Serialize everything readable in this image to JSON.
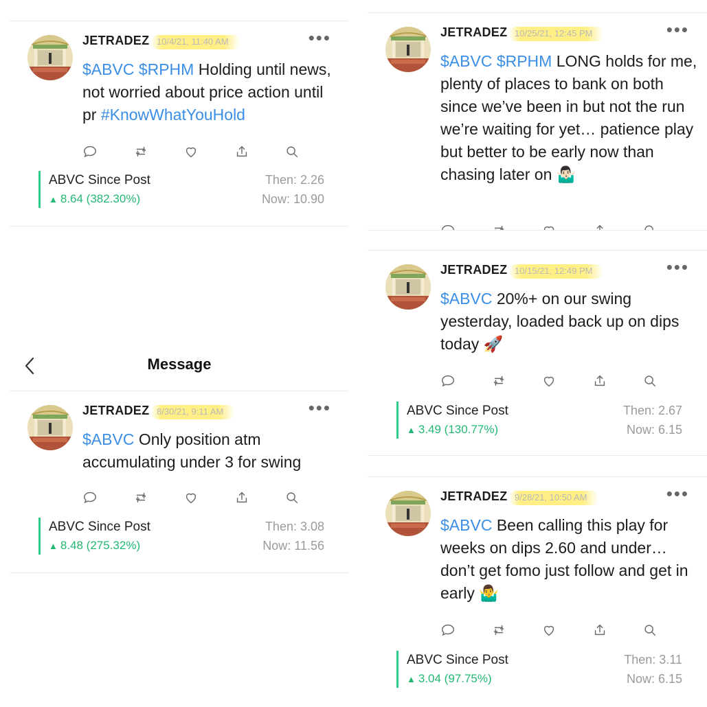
{
  "posts": {
    "p1": {
      "username": "JETRADEZ",
      "timestamp": "10/4/21, 11:40 AM",
      "segments": [
        {
          "text": "$ABVC $RPHM",
          "tag": true
        },
        {
          "text": " Holding until news, not worried about price action until pr ",
          "tag": false
        },
        {
          "text": "#KnowWhatYouHold",
          "tag": true
        }
      ],
      "stats": {
        "label": "ABVC Since Post",
        "change": "8.64 (382.30%)",
        "then": "Then: 2.26",
        "now": "Now: 10.90"
      }
    },
    "p2": {
      "username": "JETRADEZ",
      "timestamp": "8/30/21, 9:11 AM",
      "segments": [
        {
          "text": "$ABVC",
          "tag": true
        },
        {
          "text": " Only position atm accumulating under 3 for swing",
          "tag": false
        }
      ],
      "stats": {
        "label": "ABVC Since Post",
        "change": "8.48 (275.32%)",
        "then": "Then: 3.08",
        "now": "Now: 11.56"
      }
    },
    "p3": {
      "username": "JETRADEZ",
      "timestamp": "10/25/21, 12:45 PM",
      "segments": [
        {
          "text": "$ABVC $RPHM",
          "tag": true
        },
        {
          "text": " LONG holds for me, plenty of places to bank on both since we’ve been in but not the run we’re waiting for yet… patience play but better to be early now than chasing later on 🤷🏻‍♂️",
          "tag": false
        }
      ]
    },
    "p4": {
      "username": "JETRADEZ",
      "timestamp": "10/15/21, 12:49 PM",
      "segments": [
        {
          "text": "$ABVC",
          "tag": true
        },
        {
          "text": " 20%+ on our swing yesterday, loaded back up on dips today 🚀",
          "tag": false
        }
      ],
      "stats": {
        "label": "ABVC Since Post",
        "change": "3.49 (130.77%)",
        "then": "Then: 2.67",
        "now": "Now: 6.15"
      }
    },
    "p5": {
      "username": "JETRADEZ",
      "timestamp": "9/28/21, 10:50 AM",
      "segments": [
        {
          "text": "$ABVC",
          "tag": true
        },
        {
          "text": " Been calling this play for weeks on dips 2.60 and under… don’t get fomo just follow and get in early 🤷‍♂️",
          "tag": false
        }
      ],
      "stats": {
        "label": "ABVC Since Post",
        "change": "3.04 (97.75%)",
        "then": "Then: 3.11",
        "now": "Now: 6.15"
      }
    }
  },
  "message_screen": {
    "title": "Message"
  },
  "more_glyph": "•••",
  "trend_glyph": "▲",
  "colors": {
    "tag": "#3a8ee6",
    "positive": "#22b873",
    "bar": "#2fcb89",
    "highlight": "#ffec6e"
  },
  "icons": [
    "reply-icon",
    "reshare-icon",
    "like-icon",
    "share-icon",
    "search-icon"
  ]
}
